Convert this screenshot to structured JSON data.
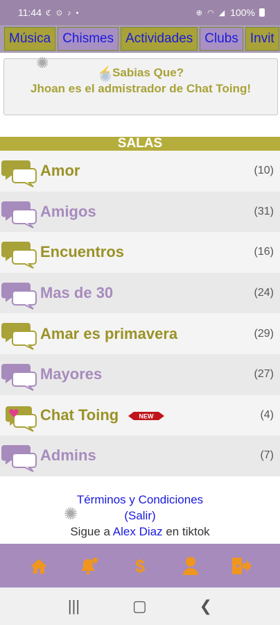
{
  "status_bar": {
    "time": "11:44",
    "left_icons": "ℭ ⊙ ♪ •",
    "right_icons": "⊕ ◠ ◢",
    "battery": "100%"
  },
  "tabs": [
    {
      "label": "Música",
      "style": "olive"
    },
    {
      "label": "Chismes",
      "style": "purple"
    },
    {
      "label": "Actividades",
      "style": "olive"
    },
    {
      "label": "Clubs",
      "style": "purple"
    },
    {
      "label": "Invit",
      "style": "olive"
    }
  ],
  "info": {
    "title": "Sabias Que?",
    "message": "Jhoan es el admistrador de Chat Toing!"
  },
  "salas_header": "SALAS",
  "rooms": [
    {
      "name": "Amor",
      "count": "(10)",
      "color": "olive"
    },
    {
      "name": "Amigos",
      "count": "(31)",
      "color": "purple"
    },
    {
      "name": "Encuentros",
      "count": "(16)",
      "color": "olive"
    },
    {
      "name": "Mas de 30",
      "count": "(24)",
      "color": "purple"
    },
    {
      "name": "Amar es primavera",
      "count": "(29)",
      "color": "olive"
    },
    {
      "name": "Mayores",
      "count": "(27)",
      "color": "purple"
    },
    {
      "name": "Chat Toing",
      "count": "(4)",
      "color": "olive",
      "badge": "NEW"
    },
    {
      "name": "Admins",
      "count": "(7)",
      "color": "purple"
    }
  ],
  "footer": {
    "terms": "Términos y Condiciones",
    "exit": "(Salir)",
    "follow_prefix": "Sigue a",
    "follow_name": "Alex Diaz",
    "follow_suffix": "en tiktok"
  },
  "bottom_nav": [
    "home-icon",
    "bell-icon",
    "dollar-icon",
    "user-icon",
    "logout-icon"
  ],
  "colors": {
    "accent_olive": "#a8a238",
    "accent_purple": "#a78bbd",
    "link_blue": "#1a1adb",
    "nav_icon_orange": "#f0961e"
  }
}
